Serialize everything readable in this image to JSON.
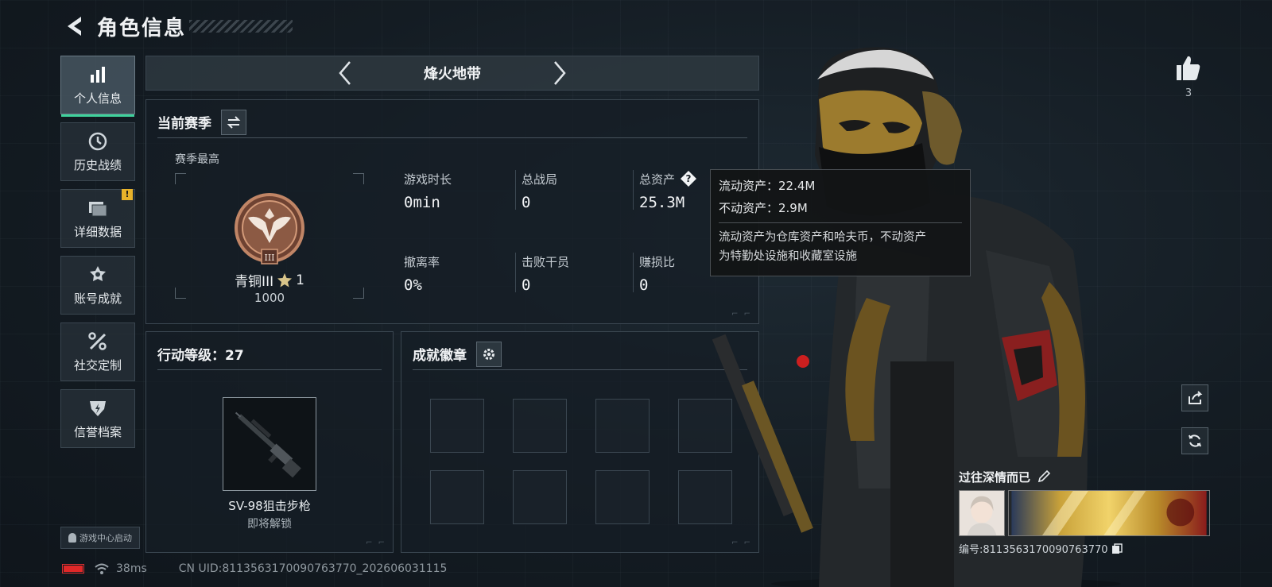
{
  "header": {
    "title": "角色信息",
    "back_icon": "back-arrow-icon"
  },
  "sidebar": {
    "items": [
      {
        "label": "个人信息",
        "icon": "bar-chart-icon",
        "active": true
      },
      {
        "label": "历史战绩",
        "icon": "clock-history-icon"
      },
      {
        "label": "详细数据",
        "icon": "folders-icon",
        "badge": "!"
      },
      {
        "label": "账号成就",
        "icon": "achievement-icon"
      },
      {
        "label": "社交定制",
        "icon": "tools-icon"
      },
      {
        "label": "信誉档案",
        "icon": "shield-bolt-icon"
      }
    ]
  },
  "launch": {
    "label": "游戏中心启动"
  },
  "status": {
    "ping": "38ms",
    "uid": "CN UID:8113563170090763770_202606031115",
    "battery_color": "#e02828"
  },
  "mode": {
    "title": "烽火地带"
  },
  "season": {
    "title": "当前赛季",
    "best_label": "赛季最高",
    "rank_name": "青铜III",
    "rank_star": "1",
    "rank_score": "1000",
    "stats": [
      {
        "label": "游戏时长",
        "value": "0min"
      },
      {
        "label": "总战局",
        "value": "0"
      },
      {
        "label": "总资产",
        "value": "25.3M"
      },
      {
        "label": "撤离率",
        "value": "0%"
      },
      {
        "label": "击败干员",
        "value": "0"
      },
      {
        "label": "赚损比",
        "value": "0"
      }
    ]
  },
  "tooltip": {
    "liquid": "流动资产：22.4M",
    "fixed": "不动资产：2.9M",
    "desc_line1": "流动资产为仓库资产和哈夫币，不动资产",
    "desc_line2": "为特勤处设施和收藏室设施"
  },
  "level": {
    "title": "行动等级：27",
    "weapon_name": "SV-98狙击步枪",
    "weapon_status": "即将解锁"
  },
  "badges": {
    "title": "成就徽章"
  },
  "social": {
    "like_count": "3"
  },
  "player": {
    "name": "过往深情而已",
    "id": "编号:8113563170090763770"
  },
  "colors": {
    "accent": "#3fd29c",
    "badge": "#e8b22a",
    "rank_bronze": "#b0785a"
  }
}
